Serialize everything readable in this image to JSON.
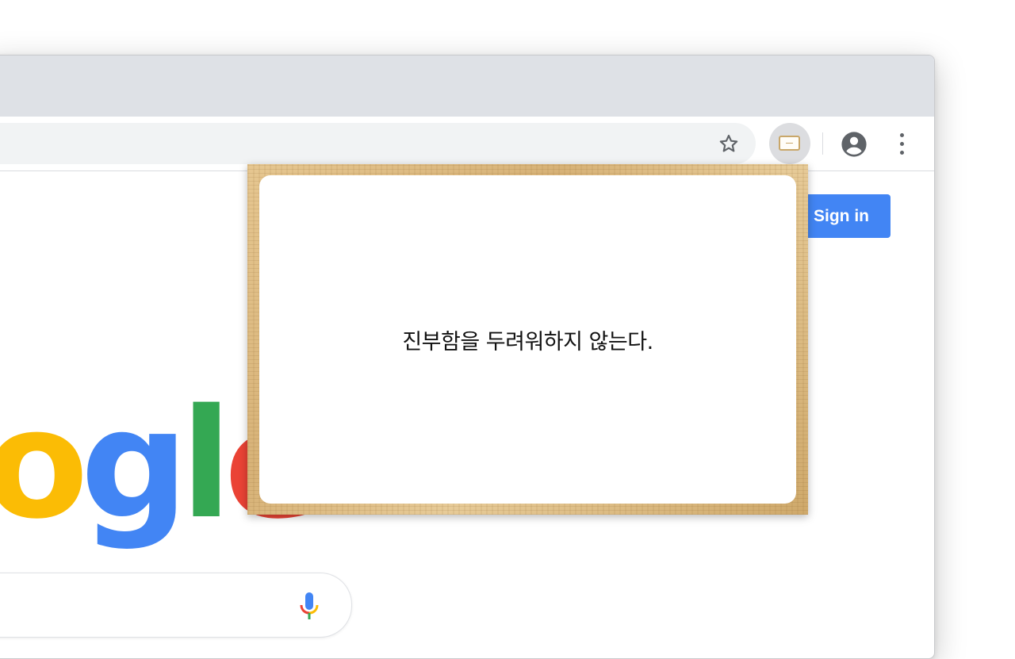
{
  "browser": {
    "toolbar": {
      "bookmark_icon": "star-outline-icon",
      "extension_icon": "wooden-frame-icon",
      "account_icon": "account-circle-icon",
      "menu_icon": "more-vert-icon"
    }
  },
  "page": {
    "signin_label": "Sign in",
    "logo_letters": [
      "o",
      "g",
      "l",
      "e"
    ],
    "search": {
      "mic_icon": "microphone-icon"
    }
  },
  "popup": {
    "quote": "진부함을 두려워하지 않는다."
  },
  "colors": {
    "google_blue": "#4285f4",
    "google_yellow": "#fbbc05",
    "google_green": "#34a853",
    "google_red": "#ea4335",
    "tabstrip": "#dee1e6"
  }
}
